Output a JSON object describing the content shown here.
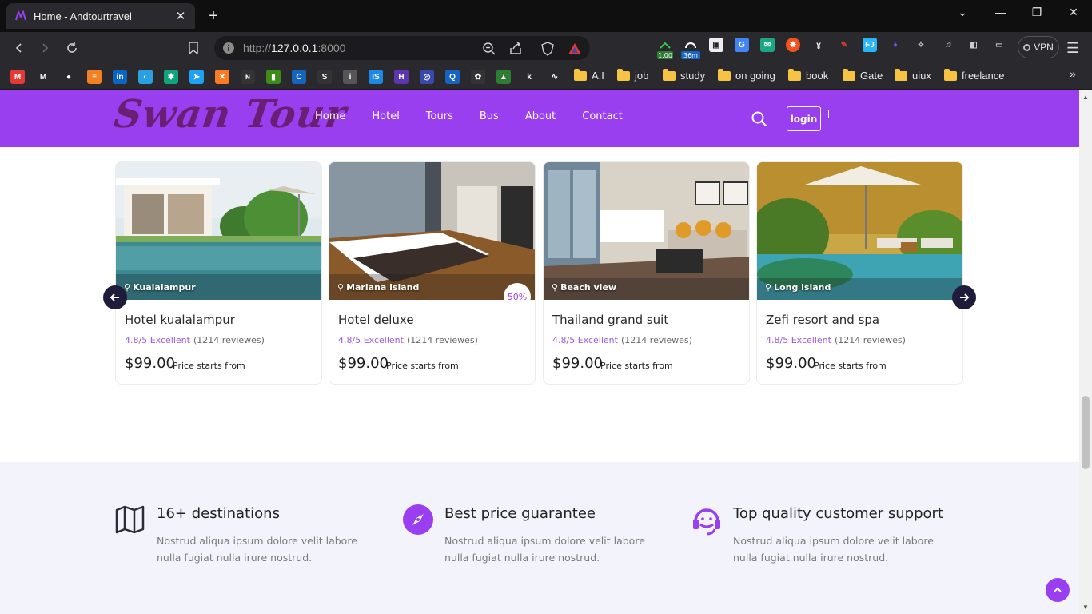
{
  "browser": {
    "tab_title": "Home - Andtourtravel",
    "close_tab": "✕",
    "new_tab": "+",
    "url_prefix": "http://",
    "url_host": "127.0.0.1",
    "url_port": ":8000",
    "vpn_label": "VPN",
    "ext_badges": [
      "1.00",
      "36m"
    ],
    "bookmark_folders": [
      "A.I",
      "job",
      "study",
      "on going",
      "book",
      "Gate",
      "uiux",
      "freelance"
    ],
    "bookmark_icons": [
      {
        "name": "gmail-icon",
        "color": "#e53935",
        "glyph": "M"
      },
      {
        "name": "gmail-m-icon",
        "color": "#2a2a2e",
        "glyph": "M"
      },
      {
        "name": "github-icon",
        "color": "#2a2a2e",
        "glyph": "●"
      },
      {
        "name": "stackoverflow-icon",
        "color": "#f48024",
        "glyph": "≡"
      },
      {
        "name": "linkedin-icon",
        "color": "#0a66c2",
        "glyph": "in"
      },
      {
        "name": "edge-icon",
        "color": "#2aa0e0",
        "glyph": "◐"
      },
      {
        "name": "chatgpt-icon",
        "color": "#10a37f",
        "glyph": "✱"
      },
      {
        "name": "bird-icon",
        "color": "#1ea1f2",
        "glyph": "➤"
      },
      {
        "name": "xampp-icon",
        "color": "#fb7a24",
        "glyph": "✕"
      },
      {
        "name": "dark-site-icon",
        "color": "#333333",
        "glyph": "ɴ"
      },
      {
        "name": "bars-icon",
        "color": "#3d8c1a",
        "glyph": "▮"
      },
      {
        "name": "c-icon",
        "color": "#1565c0",
        "glyph": "C"
      },
      {
        "name": "s-icon",
        "color": "#333333",
        "glyph": "S"
      },
      {
        "name": "info-icon",
        "color": "#555555",
        "glyph": "i"
      },
      {
        "name": "is-icon",
        "color": "#1e88e5",
        "glyph": "IS"
      },
      {
        "name": "h-icon",
        "color": "#5e35b1",
        "glyph": "H"
      },
      {
        "name": "cg-icon",
        "color": "#3949ab",
        "glyph": "◎"
      },
      {
        "name": "q-icon",
        "color": "#1565c0",
        "glyph": "Q"
      },
      {
        "name": "openai-icon",
        "color": "#333333",
        "glyph": "✿"
      },
      {
        "name": "drive-icon",
        "color": "#2e7d32",
        "glyph": "▲"
      },
      {
        "name": "k-icon",
        "color": "#2a2a2e",
        "glyph": "k"
      },
      {
        "name": "spiral-icon",
        "color": "#2a2a2e",
        "glyph": "∿"
      }
    ]
  },
  "site": {
    "logo_text": "Swan Tour",
    "nav": [
      "Home",
      "Hotel",
      "Tours",
      "Bus",
      "About",
      "Contact"
    ],
    "login_label": "login",
    "accent": "#9a3ff0"
  },
  "hotels": [
    {
      "location": "Kualalampur",
      "name": "Hotel kualalampur",
      "rating": "4.8/5 Excellent",
      "reviews": "(1214 reviewes)",
      "price": "$99.00",
      "price_note": "Price starts from",
      "badge": ""
    },
    {
      "location": "Mariana island",
      "name": "Hotel deluxe",
      "rating": "4.8/5 Excellent",
      "reviews": "(1214 reviewes)",
      "price": "$99.00",
      "price_note": "Price starts from",
      "badge": "50%"
    },
    {
      "location": "Beach view",
      "name": "Thailand grand suit",
      "rating": "4.8/5 Excellent",
      "reviews": "(1214 reviewes)",
      "price": "$99.00",
      "price_note": "Price starts from",
      "badge": ""
    },
    {
      "location": "Long island",
      "name": "Zefi resort and spa",
      "rating": "4.8/5 Excellent",
      "reviews": "(1214 reviewes)",
      "price": "$99.00",
      "price_note": "Price starts from",
      "badge": ""
    }
  ],
  "features": [
    {
      "title": "16+ destinations",
      "desc": "Nostrud aliqua ipsum dolore velit labore nulla fugiat nulla irure nostrud.",
      "icon": "map-icon"
    },
    {
      "title": "Best price guarantee",
      "desc": "Nostrud aliqua ipsum dolore velit labore nulla fugiat nulla irure nostrud.",
      "icon": "compass-icon"
    },
    {
      "title": "Top quality customer support",
      "desc": "Nostrud aliqua ipsum dolore velit labore nulla fugiat nulla irure nostrud.",
      "icon": "headset-icon"
    }
  ]
}
